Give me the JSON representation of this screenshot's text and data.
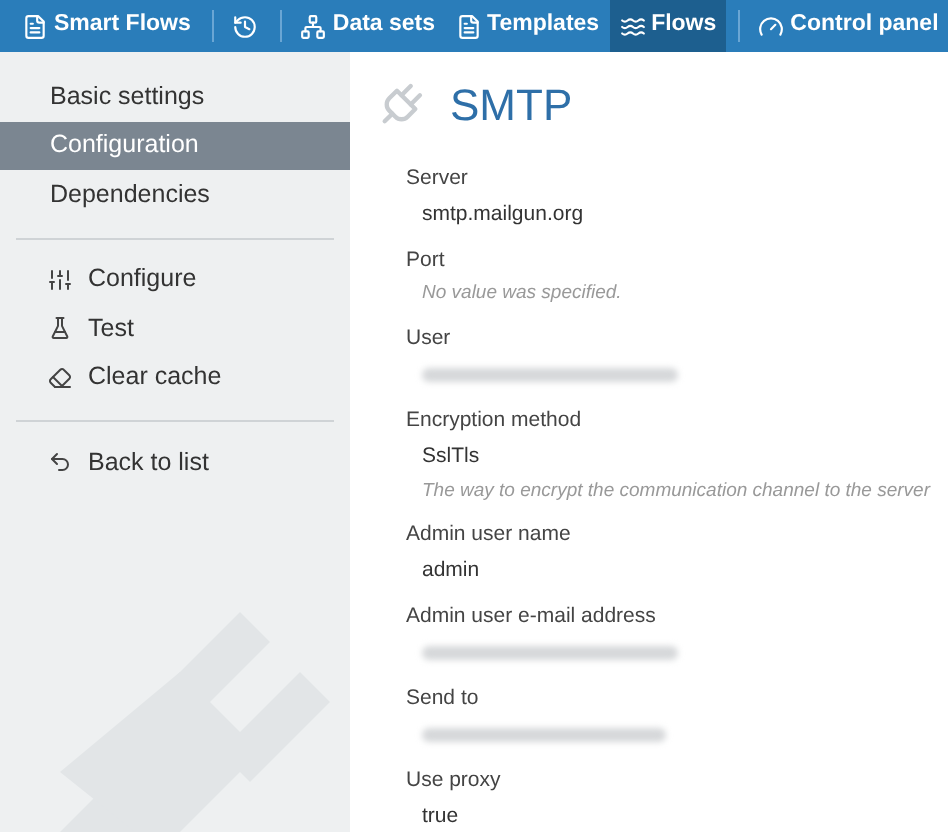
{
  "nav": {
    "groups": [
      [
        {
          "kind": "brand",
          "label": "Smart Flows",
          "selected": false
        }
      ],
      [
        {
          "kind": "history",
          "selected": false
        }
      ],
      [
        {
          "kind": "datasets",
          "label": "Data sets",
          "selected": false
        },
        {
          "kind": "templates",
          "label": "Templates",
          "selected": false
        },
        {
          "kind": "flows",
          "label": "Flows",
          "selected": true
        }
      ],
      [
        {
          "kind": "control",
          "label": "Control panel",
          "selected": false
        }
      ]
    ]
  },
  "sidebar": {
    "groups": [
      [
        {
          "label": "Basic settings",
          "selected": false
        },
        {
          "label": "Configuration",
          "selected": true
        },
        {
          "label": "Dependencies",
          "selected": false
        }
      ],
      [
        {
          "kind": "configure",
          "label": "Configure",
          "selected": false
        },
        {
          "kind": "test",
          "label": "Test",
          "selected": false
        },
        {
          "kind": "clear",
          "label": "Clear cache",
          "selected": false
        }
      ],
      [
        {
          "kind": "back",
          "label": "Back to list",
          "selected": false
        }
      ]
    ]
  },
  "page": {
    "title": "SMTP",
    "fields": [
      {
        "label": "Server",
        "kind": "text",
        "value": "smtp.mailgun.org"
      },
      {
        "label": "Port",
        "kind": "empty",
        "value": "No value was specified."
      },
      {
        "label": "User",
        "kind": "blurred"
      },
      {
        "label": "Encryption method",
        "kind": "text",
        "value": "SslTls",
        "hint": "The way to encrypt the communication channel to the server"
      },
      {
        "label": "Admin user name",
        "kind": "text",
        "value": "admin"
      },
      {
        "label": "Admin user e-mail address",
        "kind": "blurred"
      },
      {
        "label": "Send to",
        "kind": "blurred"
      },
      {
        "label": "Use proxy",
        "kind": "text",
        "value": "true"
      }
    ]
  }
}
